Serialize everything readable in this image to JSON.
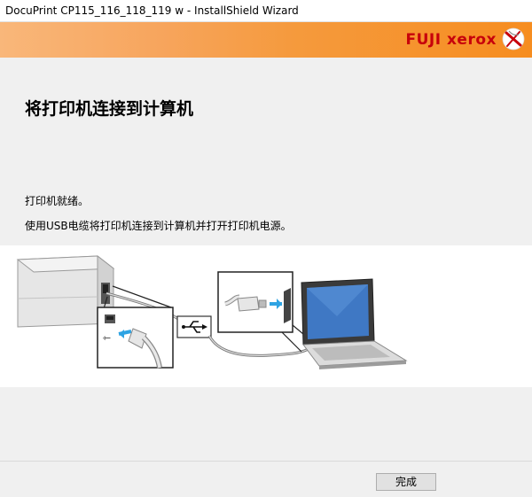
{
  "window": {
    "title": "DocuPrint CP115_116_118_119 w - InstallShield Wizard"
  },
  "banner": {
    "brand": "FUJI xerox",
    "brand_color": "#c7000b",
    "logo_icon": "xerox-sphere-icon"
  },
  "main": {
    "heading": "将打印机连接到计算机",
    "status_text": "打印机就绪。",
    "instruction_text": "使用USB电缆将打印机连接到计算机并打开打印机电源。"
  },
  "illustration": {
    "icons": [
      "printer-icon",
      "usb-plug-icon",
      "usb-symbol-icon",
      "laptop-icon"
    ]
  },
  "footer": {
    "finish_label": "完成"
  }
}
